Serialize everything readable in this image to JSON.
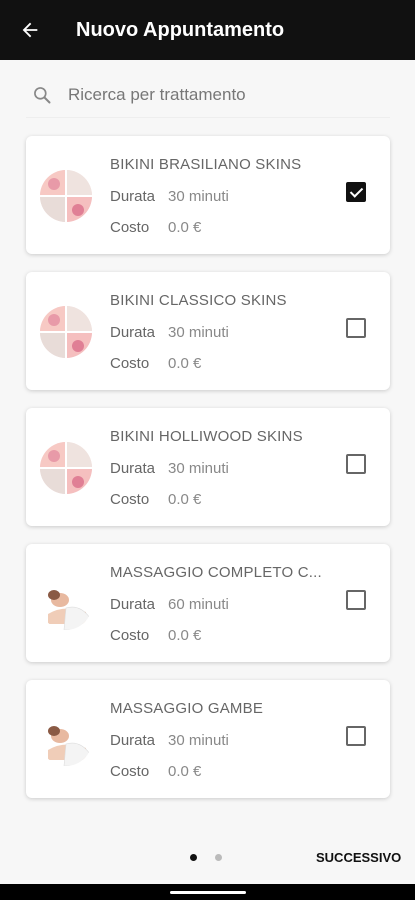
{
  "header": {
    "title": "Nuovo Appuntamento",
    "back_icon": "arrow-left-icon"
  },
  "search": {
    "placeholder": "Ricerca per trattamento",
    "value": ""
  },
  "labels": {
    "duration": "Durata",
    "cost": "Costo"
  },
  "treatments": [
    {
      "name": "BIKINI BRASILIANO SKINS",
      "duration": "30 minuti",
      "cost": "0.0 €",
      "checked": true,
      "image": "bikini-wax-thumbnail"
    },
    {
      "name": "BIKINI CLASSICO SKINS",
      "duration": "30 minuti",
      "cost": "0.0 €",
      "checked": false,
      "image": "bikini-wax-thumbnail"
    },
    {
      "name": "BIKINI HOLLIWOOD SKINS",
      "duration": "30 minuti",
      "cost": "0.0 €",
      "checked": false,
      "image": "bikini-wax-thumbnail"
    },
    {
      "name": "MASSAGGIO COMPLETO C...",
      "duration": "60 minuti",
      "cost": "0.0 €",
      "checked": false,
      "image": "massage-thumbnail"
    },
    {
      "name": "MASSAGGIO GAMBE",
      "duration": "30 minuti",
      "cost": "0.0 €",
      "checked": false,
      "image": "massage-thumbnail"
    }
  ],
  "pager": {
    "pages": 2,
    "current": 1
  },
  "footer": {
    "next_label": "SUCCESSIVO"
  },
  "colors": {
    "appbar": "#111111",
    "background": "#f7f7f7",
    "card": "#ffffff",
    "checkbox_on": "#111111"
  }
}
